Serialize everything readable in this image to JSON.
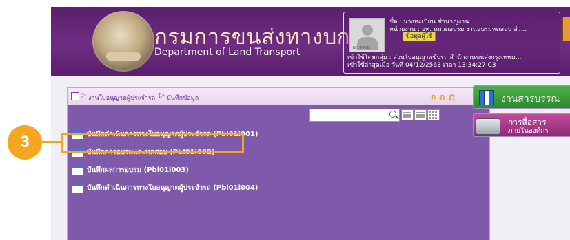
{
  "header": {
    "title_th": "กรมการขนส่งทางบก",
    "title_en": "Department of Land Transport"
  },
  "user": {
    "avatar_caption": "NO IMAGE",
    "name_line": "ชื่อ :  นางทะเบียน ชำนาญงาน",
    "unit_line": "หน่วยงาน : อท. หมวดอบรม งานอบรมทดสอบ ส่ว...",
    "info_button": "ข้อมูลผู้ใช้",
    "group_line": "เข้าใช้โดยกลุ่ม : ส่วนใบอนุญาตขับรถ สำนักงานขนส่งกรุงเทพม...",
    "last_login_line": "เข้าใช้ล่าสุดเมื่อ วันที่ 04/12/2563 เวลา 13:34:27 C3"
  },
  "breadcrumb": {
    "level1": "งานใบอนุญาตผู้ประจำรถ",
    "level2": "บันทึกข้อมูล"
  },
  "font_size_buttons": [
    "ก",
    "ก",
    "ก"
  ],
  "search": {
    "placeholder": ""
  },
  "menu_items": [
    {
      "label": "บันทึกดำเนินการทางใบอนุญาตผู้ประจำรถ (Pbl01i001)"
    },
    {
      "label": "บันทึกการอบรมและทดสอบ (Pbl01i002)"
    },
    {
      "label": "บันทึกผลการอบรม (Pbl01i003)"
    },
    {
      "label": "บันทึกดำเนินการทางใบอนุญาตผู้ประจำรถ (Pbl01i004)"
    }
  ],
  "sidebar": {
    "archive_label": "งานสารบรรณ",
    "comm_label_1": "การสื่อสาร",
    "comm_label_2": "ภายในองค์กร"
  },
  "annotation": {
    "step": "3"
  },
  "colors": {
    "header_purple": "#6e2d82",
    "panel_purple": "#7f5aaa",
    "highlight_orange": "#f3a61f"
  }
}
